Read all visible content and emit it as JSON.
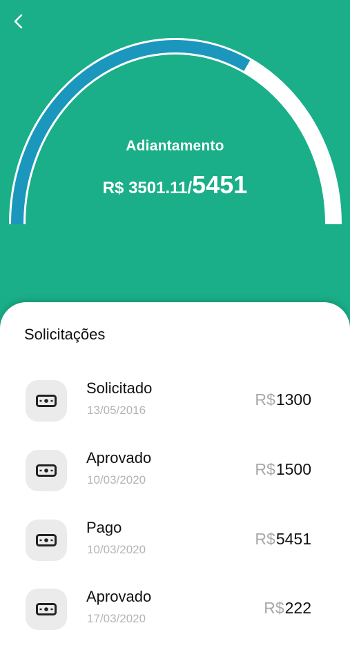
{
  "header": {
    "title": "Adiantamento",
    "current_value": "R$ 3501.11",
    "separator": "/",
    "limit_value": "5451",
    "progress_fraction": 0.642
  },
  "colors": {
    "background": "#1aaf88",
    "gauge_progress": "#1b97bd",
    "gauge_track": "#ffffff",
    "text_muted": "#b4b4b4"
  },
  "requests": {
    "title": "Solicitações",
    "items": [
      {
        "status": "Solicitado",
        "date": "13/05/2016",
        "currency": "R$",
        "amount": "1300",
        "icon": "money-icon"
      },
      {
        "status": "Aprovado",
        "date": "10/03/2020",
        "currency": "R$",
        "amount": "1500",
        "icon": "money-icon"
      },
      {
        "status": "Pago",
        "date": "10/03/2020",
        "currency": "R$",
        "amount": "5451",
        "icon": "money-icon"
      },
      {
        "status": "Aprovado",
        "date": "17/03/2020",
        "currency": "R$",
        "amount": "222",
        "icon": "money-icon"
      }
    ]
  }
}
